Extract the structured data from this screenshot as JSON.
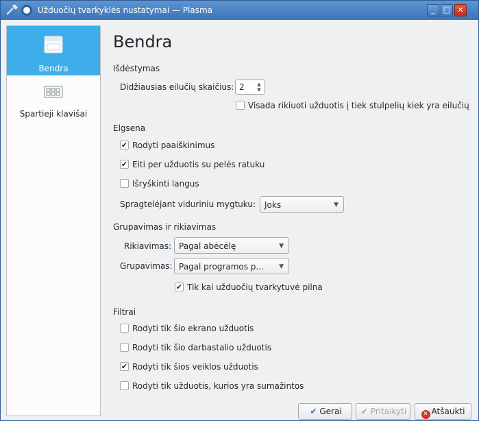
{
  "window": {
    "title": "Užduočių tvarkyklės nustatymai — Plasma",
    "minimize_glyph": "_",
    "maximize_glyph": "□",
    "close_glyph": "✕"
  },
  "sidebar": {
    "items": [
      {
        "label": "Bendra",
        "icon": "general-settings-icon",
        "active": true
      },
      {
        "label": "Spartieji klavišai",
        "icon": "keyboard-icon",
        "active": false
      }
    ]
  },
  "page": {
    "title": "Bendra",
    "layout": {
      "heading": "Išdėstymas",
      "max_rows_label": "Didžiausias eilučių skaičius:",
      "max_rows_value": "2",
      "always_sort_label": "Visada rikiuoti užduotis į tiek stulpelių kiek yra eilučių",
      "always_sort_checked": false
    },
    "behavior": {
      "heading": "Elgsena",
      "show_tooltips_label": "Rodyti paaiškinimus",
      "show_tooltips_checked": true,
      "wheel_label": "Eiti per užduotis su pelės ratuku",
      "wheel_checked": true,
      "highlight_label": "Išryškinti langus",
      "highlight_checked": false,
      "middle_click_label": "Spragtelėjant viduriniu mygtuku:",
      "middle_click_value": "Joks"
    },
    "grouping": {
      "heading": "Grupavimas ir rikiavimas",
      "sorting_label": "Rikiavimas:",
      "sorting_value": "Pagal abėcėlę",
      "grouping_label": "Grupavimas:",
      "grouping_value": "Pagal programos p...",
      "only_full_label": "Tik kai užduočių tvarkytuvė pilna",
      "only_full_checked": true
    },
    "filters": {
      "heading": "Filtrai",
      "screen_label": "Rodyti tik šio ekrano užduotis",
      "screen_checked": false,
      "desktop_label": "Rodyti tik šio darbastalio užduotis",
      "desktop_checked": false,
      "activity_label": "Rodyti tik šios veiklos užduotis",
      "activity_checked": true,
      "minimized_label": "Rodyti tik užduotis, kurios yra sumažintos",
      "minimized_checked": false
    }
  },
  "buttons": {
    "ok": "Gerai",
    "apply": "Pritaikyti",
    "cancel": "Atšaukti"
  },
  "glyphs": {
    "check": "✔",
    "spin_up": "▲",
    "spin_down": "▼",
    "dropdown": "▼"
  }
}
